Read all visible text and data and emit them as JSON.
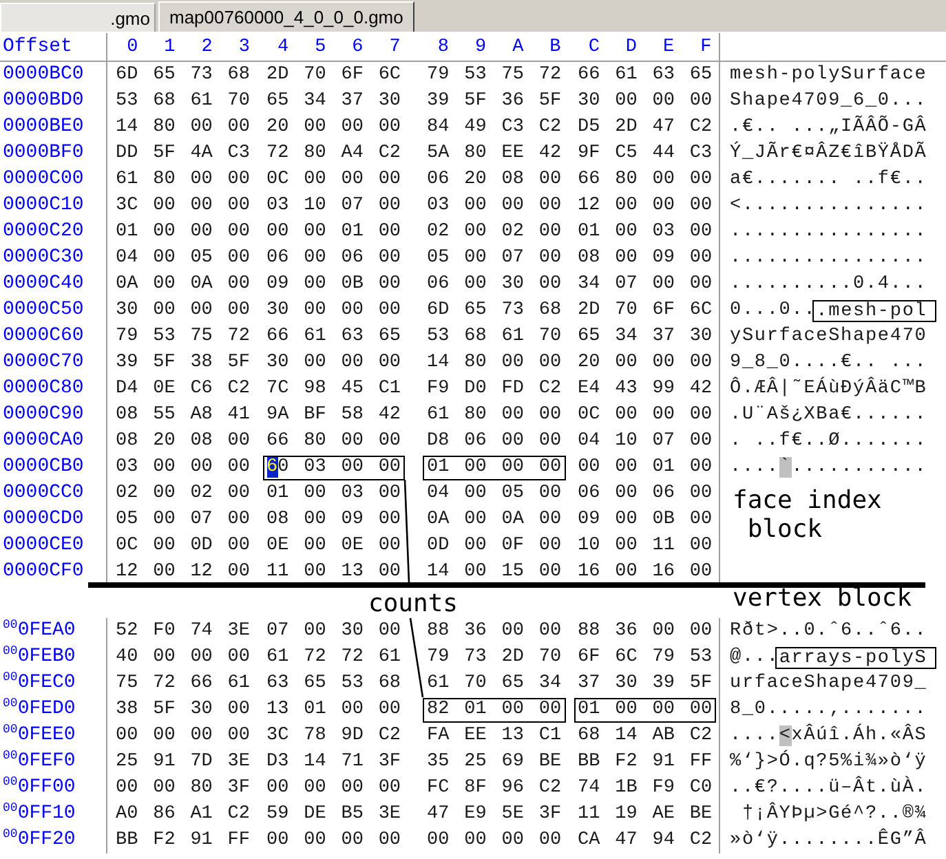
{
  "tabs": [
    {
      "label": ".gmo",
      "selected": false
    },
    {
      "label": "map00760000_4_0_0_0.gmo",
      "selected": true
    }
  ],
  "header": {
    "offset": "Offset",
    "columns": [
      "0",
      "1",
      "2",
      "3",
      "4",
      "5",
      "6",
      "7",
      "8",
      "9",
      "A",
      "B",
      "C",
      "D",
      "E",
      "F"
    ]
  },
  "upper_block": {
    "rows": [
      {
        "offset": "0000BC0",
        "groups": [
          {
            "hex": "6D 65 73 68",
            "boxed": false,
            "cursor": false
          },
          {
            "hex": "2D 70 6F 6C",
            "boxed": false,
            "cursor": false
          },
          {
            "hex": "79 53 75 72",
            "boxed": false,
            "cursor": false
          },
          {
            "hex": "66 61 63 65",
            "boxed": false,
            "cursor": false
          }
        ],
        "ascii": [
          {
            "kind": "plain",
            "text": "mesh-polySurface"
          }
        ]
      },
      {
        "offset": "0000BD0",
        "groups": [
          {
            "hex": "53 68 61 70",
            "boxed": false,
            "cursor": false
          },
          {
            "hex": "65 34 37 30",
            "boxed": false,
            "cursor": false
          },
          {
            "hex": "39 5F 36 5F",
            "boxed": false,
            "cursor": false
          },
          {
            "hex": "30 00 00 00",
            "boxed": false,
            "cursor": false
          }
        ],
        "ascii": [
          {
            "kind": "plain",
            "text": "Shape4709_6_0..."
          }
        ]
      },
      {
        "offset": "0000BE0",
        "groups": [
          {
            "hex": "14 80 00 00",
            "boxed": false,
            "cursor": false
          },
          {
            "hex": "20 00 00 00",
            "boxed": false,
            "cursor": false
          },
          {
            "hex": "84 49 C3 C2",
            "boxed": false,
            "cursor": false
          },
          {
            "hex": "D5 2D 47 C2",
            "boxed": false,
            "cursor": false
          }
        ],
        "ascii": [
          {
            "kind": "plain",
            "text": ".€.. ...„IÃÂÕ-GÂ"
          }
        ]
      },
      {
        "offset": "0000BF0",
        "groups": [
          {
            "hex": "DD 5F 4A C3",
            "boxed": false,
            "cursor": false
          },
          {
            "hex": "72 80 A4 C2",
            "boxed": false,
            "cursor": false
          },
          {
            "hex": "5A 80 EE 42",
            "boxed": false,
            "cursor": false
          },
          {
            "hex": "9F C5 44 C3",
            "boxed": false,
            "cursor": false
          }
        ],
        "ascii": [
          {
            "kind": "plain",
            "text": "Ý_JÃr€¤ÂZ€îBŸÅDÃ"
          }
        ]
      },
      {
        "offset": "0000C00",
        "groups": [
          {
            "hex": "61 80 00 00",
            "boxed": false,
            "cursor": false
          },
          {
            "hex": "0C 00 00 00",
            "boxed": false,
            "cursor": false
          },
          {
            "hex": "06 20 08 00",
            "boxed": false,
            "cursor": false
          },
          {
            "hex": "66 80 00 00",
            "boxed": false,
            "cursor": false
          }
        ],
        "ascii": [
          {
            "kind": "plain",
            "text": "a€....... ..f€.."
          }
        ]
      },
      {
        "offset": "0000C10",
        "groups": [
          {
            "hex": "3C 00 00 00",
            "boxed": false,
            "cursor": false
          },
          {
            "hex": "03 10 07 00",
            "boxed": false,
            "cursor": false
          },
          {
            "hex": "03 00 00 00",
            "boxed": false,
            "cursor": false
          },
          {
            "hex": "12 00 00 00",
            "boxed": false,
            "cursor": false
          }
        ],
        "ascii": [
          {
            "kind": "plain",
            "text": "<..............."
          }
        ]
      },
      {
        "offset": "0000C20",
        "groups": [
          {
            "hex": "01 00 00 00",
            "boxed": false,
            "cursor": false
          },
          {
            "hex": "00 00 01 00",
            "boxed": false,
            "cursor": false
          },
          {
            "hex": "02 00 02 00",
            "boxed": false,
            "cursor": false
          },
          {
            "hex": "01 00 03 00",
            "boxed": false,
            "cursor": false
          }
        ],
        "ascii": [
          {
            "kind": "plain",
            "text": "................"
          }
        ]
      },
      {
        "offset": "0000C30",
        "groups": [
          {
            "hex": "04 00 05 00",
            "boxed": false,
            "cursor": false
          },
          {
            "hex": "06 00 06 00",
            "boxed": false,
            "cursor": false
          },
          {
            "hex": "05 00 07 00",
            "boxed": false,
            "cursor": false
          },
          {
            "hex": "08 00 09 00",
            "boxed": false,
            "cursor": false
          }
        ],
        "ascii": [
          {
            "kind": "plain",
            "text": "................"
          }
        ]
      },
      {
        "offset": "0000C40",
        "groups": [
          {
            "hex": "0A 00 0A 00",
            "boxed": false,
            "cursor": false
          },
          {
            "hex": "09 00 0B 00",
            "boxed": false,
            "cursor": false
          },
          {
            "hex": "06 00 30 00",
            "boxed": false,
            "cursor": false
          },
          {
            "hex": "34 07 00 00",
            "boxed": false,
            "cursor": false
          }
        ],
        "ascii": [
          {
            "kind": "plain",
            "text": "..........0.4..."
          }
        ]
      },
      {
        "offset": "0000C50",
        "groups": [
          {
            "hex": "30 00 00 00",
            "boxed": false,
            "cursor": false
          },
          {
            "hex": "30 00 00 00",
            "boxed": false,
            "cursor": false
          },
          {
            "hex": "6D 65 73 68",
            "boxed": false,
            "cursor": false
          },
          {
            "hex": "2D 70 6F 6C",
            "boxed": false,
            "cursor": false
          }
        ],
        "ascii": [
          {
            "kind": "plain",
            "text": "0...0.."
          },
          {
            "kind": "framed",
            "text": ".mesh-pol"
          }
        ]
      },
      {
        "offset": "0000C60",
        "groups": [
          {
            "hex": "79 53 75 72",
            "boxed": false,
            "cursor": false
          },
          {
            "hex": "66 61 63 65",
            "boxed": false,
            "cursor": false
          },
          {
            "hex": "53 68 61 70",
            "boxed": false,
            "cursor": false
          },
          {
            "hex": "65 34 37 30",
            "boxed": false,
            "cursor": false
          }
        ],
        "ascii": [
          {
            "kind": "plain",
            "text": "ySurfaceShape470"
          }
        ]
      },
      {
        "offset": "0000C70",
        "groups": [
          {
            "hex": "39 5F 38 5F",
            "boxed": false,
            "cursor": false
          },
          {
            "hex": "30 00 00 00",
            "boxed": false,
            "cursor": false
          },
          {
            "hex": "14 80 00 00",
            "boxed": false,
            "cursor": false
          },
          {
            "hex": "20 00 00 00",
            "boxed": false,
            "cursor": false
          }
        ],
        "ascii": [
          {
            "kind": "plain",
            "text": "9_8_0....€.. ..."
          }
        ]
      },
      {
        "offset": "0000C80",
        "groups": [
          {
            "hex": "D4 0E C6 C2",
            "boxed": false,
            "cursor": false
          },
          {
            "hex": "7C 98 45 C1",
            "boxed": false,
            "cursor": false
          },
          {
            "hex": "F9 D0 FD C2",
            "boxed": false,
            "cursor": false
          },
          {
            "hex": "E4 43 99 42",
            "boxed": false,
            "cursor": false
          }
        ],
        "ascii": [
          {
            "kind": "plain",
            "text": "Ô.ÆÂ|˜EÁùÐýÂäC™B"
          }
        ]
      },
      {
        "offset": "0000C90",
        "groups": [
          {
            "hex": "08 55 A8 41",
            "boxed": false,
            "cursor": false
          },
          {
            "hex": "9A BF 58 42",
            "boxed": false,
            "cursor": false
          },
          {
            "hex": "61 80 00 00",
            "boxed": false,
            "cursor": false
          },
          {
            "hex": "0C 00 00 00",
            "boxed": false,
            "cursor": false
          }
        ],
        "ascii": [
          {
            "kind": "plain",
            "text": ".U¨Aš¿XBa€......"
          }
        ]
      },
      {
        "offset": "0000CA0",
        "groups": [
          {
            "hex": "08 20 08 00",
            "boxed": false,
            "cursor": false
          },
          {
            "hex": "66 80 00 00",
            "boxed": false,
            "cursor": false
          },
          {
            "hex": "D8 06 00 00",
            "boxed": false,
            "cursor": false
          },
          {
            "hex": "04 10 07 00",
            "boxed": false,
            "cursor": false
          }
        ],
        "ascii": [
          {
            "kind": "plain",
            "text": ". ..f€..Ø......."
          }
        ]
      },
      {
        "offset": "0000CB0",
        "groups": [
          {
            "hex": "03 00 00 00",
            "boxed": false,
            "cursor": false
          },
          {
            "hex": "60 03 00 00",
            "boxed": true,
            "cursor": true
          },
          {
            "hex": "01 00 00 00",
            "boxed": true,
            "cursor": false
          },
          {
            "hex": "00 00 01 00",
            "boxed": false,
            "cursor": false
          }
        ],
        "ascii": [
          {
            "kind": "plain",
            "text": "...."
          },
          {
            "kind": "shaded",
            "text": "`"
          },
          {
            "kind": "plain",
            "text": "..........."
          }
        ]
      },
      {
        "offset": "0000CC0",
        "groups": [
          {
            "hex": "02 00 02 00",
            "boxed": false,
            "cursor": false
          },
          {
            "hex": "01 00 03 00",
            "boxed": false,
            "cursor": false
          },
          {
            "hex": "04 00 05 00",
            "boxed": false,
            "cursor": false
          },
          {
            "hex": "06 00 06 00",
            "boxed": false,
            "cursor": false
          }
        ]
      },
      {
        "offset": "0000CD0",
        "groups": [
          {
            "hex": "05 00 07 00",
            "boxed": false,
            "cursor": false
          },
          {
            "hex": "08 00 09 00",
            "boxed": false,
            "cursor": false
          },
          {
            "hex": "0A 00 0A 00",
            "boxed": false,
            "cursor": false
          },
          {
            "hex": "09 00 0B 00",
            "boxed": false,
            "cursor": false
          }
        ]
      },
      {
        "offset": "0000CE0",
        "groups": [
          {
            "hex": "0C 00 0D 00",
            "boxed": false,
            "cursor": false
          },
          {
            "hex": "0E 00 0E 00",
            "boxed": false,
            "cursor": false
          },
          {
            "hex": "0D 00 0F 00",
            "boxed": false,
            "cursor": false
          },
          {
            "hex": "10 00 11 00",
            "boxed": false,
            "cursor": false
          }
        ]
      },
      {
        "offset": "0000CF0",
        "groups": [
          {
            "hex": "12 00 12 00",
            "boxed": false,
            "cursor": false
          },
          {
            "hex": "11 00 13 00",
            "boxed": false,
            "cursor": false
          },
          {
            "hex": "14 00 15 00",
            "boxed": false,
            "cursor": false
          },
          {
            "hex": "16 00 16 00",
            "boxed": false,
            "cursor": false
          }
        ]
      }
    ],
    "note": "face index block"
  },
  "divider_labels": {
    "center": "counts",
    "right": "vertex block"
  },
  "lower_block": {
    "rows": [
      {
        "offset": "$^{00}$0FEA0",
        "groups": [
          {
            "hex": "52 F0 74 3E",
            "boxed": false,
            "cursor": false
          },
          {
            "hex": "07 00 30 00",
            "boxed": false,
            "cursor": false
          },
          {
            "hex": "88 36 00 00",
            "boxed": false,
            "cursor": false
          },
          {
            "hex": "88 36 00 00",
            "boxed": false,
            "cursor": false
          }
        ],
        "ascii": [
          {
            "kind": "plain",
            "text": "Rðt>..0.ˆ6..ˆ6.."
          }
        ]
      },
      {
        "offset": "$^{00}$0FEB0",
        "groups": [
          {
            "hex": "40 00 00 00",
            "boxed": false,
            "cursor": false
          },
          {
            "hex": "61 72 72 61",
            "boxed": false,
            "cursor": false
          },
          {
            "hex": "79 73 2D 70",
            "boxed": false,
            "cursor": false
          },
          {
            "hex": "6F 6C 79 53",
            "boxed": false,
            "cursor": false
          }
        ],
        "ascii": [
          {
            "kind": "plain",
            "text": "@..."
          },
          {
            "kind": "framed",
            "text": "arrays-polyS"
          }
        ]
      },
      {
        "offset": "$^{00}$0FEC0",
        "groups": [
          {
            "hex": "75 72 66 61",
            "boxed": false,
            "cursor": false
          },
          {
            "hex": "63 65 53 68",
            "boxed": false,
            "cursor": false
          },
          {
            "hex": "61 70 65 34",
            "boxed": false,
            "cursor": false
          },
          {
            "hex": "37 30 39 5F",
            "boxed": false,
            "cursor": false
          }
        ],
        "ascii": [
          {
            "kind": "plain",
            "text": "urfaceShape4709_"
          }
        ]
      },
      {
        "offset": "$^{00}$0FED0",
        "groups": [
          {
            "hex": "38 5F 30 00",
            "boxed": false,
            "cursor": false
          },
          {
            "hex": "13 01 00 00",
            "boxed": false,
            "cursor": false
          },
          {
            "hex": "82 01 00 00",
            "boxed": true,
            "cursor": false
          },
          {
            "hex": "01 00 00 00",
            "boxed": true,
            "cursor": false
          }
        ],
        "ascii": [
          {
            "kind": "plain",
            "text": "8_0.....‚......."
          }
        ]
      },
      {
        "offset": "$^{00}$0FEE0",
        "groups": [
          {
            "hex": "00 00 00 00",
            "boxed": false,
            "cursor": false
          },
          {
            "hex": "3C 78 9D C2",
            "boxed": false,
            "cursor": false
          },
          {
            "hex": "FA EE 13 C1",
            "boxed": false,
            "cursor": false
          },
          {
            "hex": "68 14 AB C2",
            "boxed": false,
            "cursor": false
          }
        ],
        "ascii": [
          {
            "kind": "plain",
            "text": "...."
          },
          {
            "kind": "shaded",
            "text": "<"
          },
          {
            "kind": "plain",
            "text": "xÂúî.Áh.«ÂS"
          }
        ]
      },
      {
        "offset": "$^{00}$0FEF0",
        "groups": [
          {
            "hex": "25 91 7D 3E",
            "boxed": false,
            "cursor": false
          },
          {
            "hex": "D3 14 71 3F",
            "boxed": false,
            "cursor": false
          },
          {
            "hex": "35 25 69 BE",
            "boxed": false,
            "cursor": false
          },
          {
            "hex": "BB F2 91 FF",
            "boxed": false,
            "cursor": false
          }
        ],
        "ascii": [
          {
            "kind": "plain",
            "text": "%‘}>Ó.q?5%i¾»ò‘ÿ"
          }
        ]
      },
      {
        "offset": "$^{00}$0FF00",
        "groups": [
          {
            "hex": "00 00 80 3F",
            "boxed": false,
            "cursor": false
          },
          {
            "hex": "00 00 00 00",
            "boxed": false,
            "cursor": false
          },
          {
            "hex": "FC 8F 96 C2",
            "boxed": false,
            "cursor": false
          },
          {
            "hex": "74 1B F9 C0",
            "boxed": false,
            "cursor": false
          }
        ],
        "ascii": [
          {
            "kind": "plain",
            "text": "..€?....ü–Ât.ùÀ."
          }
        ]
      },
      {
        "offset": "$^{00}$0FF10",
        "groups": [
          {
            "hex": "A0 86 A1 C2",
            "boxed": false,
            "cursor": false
          },
          {
            "hex": "59 DE B5 3E",
            "boxed": false,
            "cursor": false
          },
          {
            "hex": "47 E9 5E 3F",
            "boxed": false,
            "cursor": false
          },
          {
            "hex": "11 19 AE BE",
            "boxed": false,
            "cursor": false
          }
        ],
        "ascii": [
          {
            "kind": "plain",
            "text": " †¡ÂYÞµ>Gé^?..®¾"
          }
        ]
      },
      {
        "offset": "$^{00}$0FF20",
        "groups": [
          {
            "hex": "BB F2 91 FF",
            "boxed": false,
            "cursor": false
          },
          {
            "hex": "00 00 00 00",
            "boxed": false,
            "cursor": false
          },
          {
            "hex": "00 00 00 00",
            "boxed": false,
            "cursor": false
          },
          {
            "hex": "CA 47 94 C2",
            "boxed": false,
            "cursor": false
          }
        ],
        "ascii": [
          {
            "kind": "plain",
            "text": "»ò‘ÿ........ÊG”Â"
          }
        ]
      }
    ]
  }
}
